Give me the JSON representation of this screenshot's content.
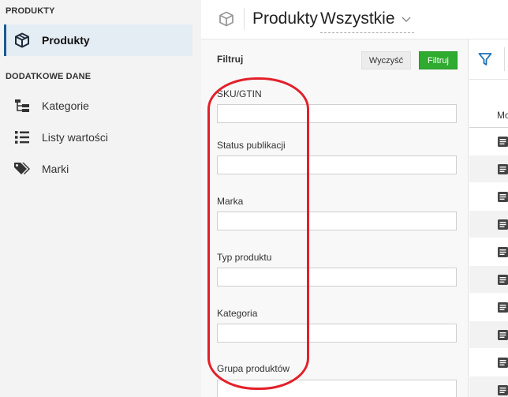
{
  "sidebar": {
    "section_products": "PRODUKTY",
    "section_additional": "DODATKOWE DANE",
    "items": [
      {
        "label": "Produkty",
        "icon": "box-icon",
        "active": true
      },
      {
        "label": "Kategorie",
        "icon": "tree-icon",
        "active": false
      },
      {
        "label": "Listy wartości",
        "icon": "list-icon",
        "active": false
      },
      {
        "label": "Marki",
        "icon": "tags-icon",
        "active": false
      }
    ]
  },
  "header": {
    "title": "Produkty",
    "view_selected": "Wszystkie",
    "icon": "box-icon"
  },
  "filter": {
    "title": "Filtruj",
    "clear_label": "Wyczyść",
    "apply_label": "Filtruj",
    "fields": [
      {
        "label": "SKU/GTIN",
        "value": ""
      },
      {
        "label": "Status publikacji",
        "value": ""
      },
      {
        "label": "Marka",
        "value": ""
      },
      {
        "label": "Typ produktu",
        "value": ""
      },
      {
        "label": "Kategoria",
        "value": ""
      },
      {
        "label": "Grupa produktów",
        "value": ""
      }
    ]
  },
  "table": {
    "column_partial": "Mo",
    "row_icon": "details-icon",
    "row_count": 10
  },
  "colors": {
    "accent": "#1b5b8f",
    "apply_button": "#2fab2f",
    "annotation": "#e3202a"
  }
}
